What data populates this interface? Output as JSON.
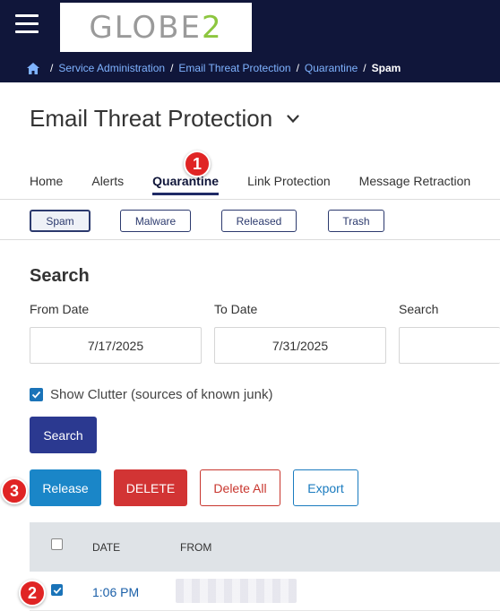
{
  "app": {
    "logo_text_main": "GLOBE",
    "logo_text_accent": "2",
    "menu_icon": "hamburger-menu-icon",
    "home_icon": "home-icon"
  },
  "breadcrumb": {
    "items": [
      "Service Administration",
      "Email Threat Protection",
      "Quarantine"
    ],
    "current": "Spam",
    "separator": "/"
  },
  "page": {
    "title": "Email Threat Protection",
    "title_dropdown_icon": "chevron-down-icon"
  },
  "tabs": [
    {
      "label": "Home",
      "active": false
    },
    {
      "label": "Alerts",
      "active": false
    },
    {
      "label": "Quarantine",
      "active": true
    },
    {
      "label": "Link Protection",
      "active": false
    },
    {
      "label": "Message Retraction",
      "active": false
    }
  ],
  "subtabs": [
    {
      "label": "Spam",
      "active": true
    },
    {
      "label": "Malware",
      "active": false
    },
    {
      "label": "Released",
      "active": false
    },
    {
      "label": "Trash",
      "active": false
    }
  ],
  "search": {
    "heading": "Search",
    "from_label": "From Date",
    "from_value": "7/17/2025",
    "to_label": "To Date",
    "to_value": "7/31/2025",
    "search_label": "Search",
    "search_value": "",
    "clutter_label": "Show Clutter (sources of known junk)",
    "clutter_checked": true,
    "search_button": "Search"
  },
  "actions": {
    "release": "Release",
    "delete": "DELETE",
    "delete_all": "Delete All",
    "export": "Export"
  },
  "table": {
    "columns": [
      "DATE",
      "FROM"
    ],
    "rows": [
      {
        "date": "1:06 PM",
        "from": "",
        "checked": true
      }
    ]
  },
  "callouts": [
    "1",
    "2",
    "3"
  ],
  "colors": {
    "topbar": "#10163a",
    "link": "#7fb3ff",
    "primary": "#2b3990",
    "release": "#1a86c8",
    "danger": "#d23434",
    "callout": "#e02424",
    "logo_accent": "#8dc63f"
  }
}
